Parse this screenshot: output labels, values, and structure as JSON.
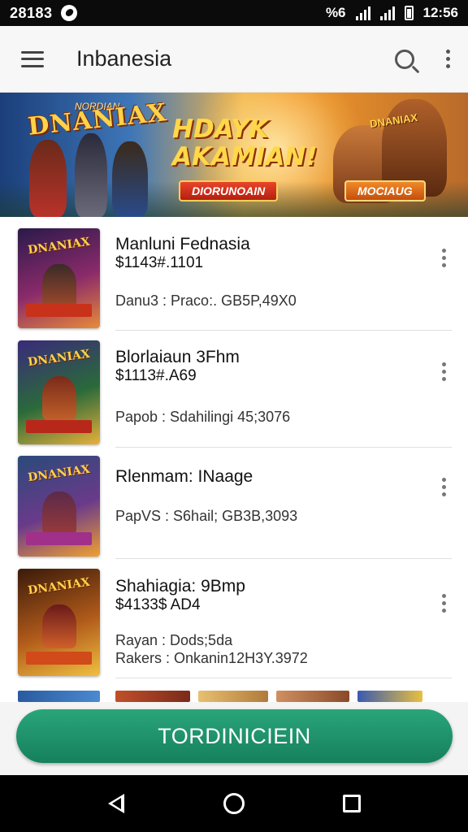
{
  "status_bar": {
    "time_left": "28183",
    "time_right": "12:56",
    "network_label": "%6"
  },
  "app_bar": {
    "title": "Inbanesia"
  },
  "banner": {
    "logo_text": "DNANIAX",
    "logo_small": "NORDIAN",
    "headline_line1": "HDAYK",
    "headline_line2": "AKAMIAN!",
    "button_left": "DIORUNOAIN",
    "button_right": "MOCIAUG",
    "badge_text": "DNANIAX"
  },
  "items": [
    {
      "title": "Manluni Fednasia",
      "price": "$1143#.1101",
      "meta1": "Danu3 : Praco:. GB5P,49X0",
      "meta2": "",
      "thumb_logo": "DNANIAX",
      "colors": [
        "#2a1a4a",
        "#8a2a6a",
        "#e88a3a"
      ]
    },
    {
      "title": "Blorlaiaun 3Fhm",
      "price": "$1113#.A69",
      "meta1": "Papob : Sdahilingi 45;3076",
      "meta2": "",
      "thumb_logo": "DNANIAX",
      "colors": [
        "#3a2a7a",
        "#2a6a3a",
        "#e8b03a"
      ]
    },
    {
      "title": "Rlenmam: INaage",
      "price": "",
      "meta1": "PapVS : S6hail; GB3B,3093",
      "meta2": "",
      "thumb_logo": "DNANIAX",
      "colors": [
        "#2a4a7a",
        "#6a3a8a",
        "#f0a030"
      ]
    },
    {
      "title": "Shahiagia: 9Bmp",
      "price": "$4133$ AD4",
      "meta1": "Rayan : Dods;5da",
      "meta2": "Rakers : Onkanin12H3Y.3972",
      "thumb_logo": "DNANIAX",
      "colors": [
        "#3a1a0a",
        "#b05a1a",
        "#f0c040"
      ]
    }
  ],
  "cta": {
    "label": "TORDINICIEIN"
  },
  "icons": {
    "menu": "hamburger-icon",
    "search": "search-icon",
    "overflow": "more-vert-icon",
    "nav_back": "back-triangle-icon",
    "nav_home": "home-circle-icon",
    "nav_recent": "recents-square-icon"
  },
  "colors": {
    "accent": "#1a8f66",
    "status_bar": "#0b0b0b",
    "app_bar": "#f7f7f7"
  }
}
